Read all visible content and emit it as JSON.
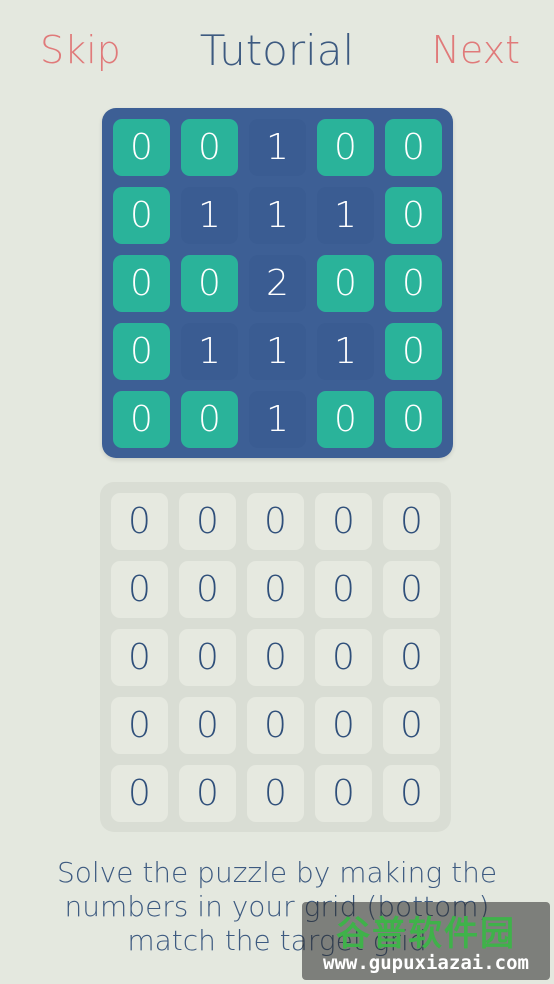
{
  "header": {
    "skip_label": "Skip",
    "title": "Tutorial",
    "next_label": "Next"
  },
  "target_grid": {
    "values": [
      [
        "0",
        "0",
        "1",
        "0",
        "0"
      ],
      [
        "0",
        "1",
        "1",
        "1",
        "0"
      ],
      [
        "0",
        "0",
        "2",
        "0",
        "0"
      ],
      [
        "0",
        "1",
        "1",
        "1",
        "0"
      ],
      [
        "0",
        "0",
        "1",
        "0",
        "0"
      ]
    ],
    "colors": {
      "board": "#3d5f95",
      "zero_cell": "#2ab39a",
      "nonzero_cell": "#3a5c92"
    }
  },
  "player_grid": {
    "values": [
      [
        "0",
        "0",
        "0",
        "0",
        "0"
      ],
      [
        "0",
        "0",
        "0",
        "0",
        "0"
      ],
      [
        "0",
        "0",
        "0",
        "0",
        "0"
      ],
      [
        "0",
        "0",
        "0",
        "0",
        "0"
      ],
      [
        "0",
        "0",
        "0",
        "0",
        "0"
      ]
    ]
  },
  "instructions": {
    "text": "Solve the puzzle by making the numbers in your grid (bottom) match the target grid"
  },
  "watermark": {
    "cn_text": "谷普软件园",
    "url_text": "www.gupuxiazai.com"
  },
  "colors": {
    "accent": "#e07a7a",
    "text": "#3d5a80",
    "background": "#e4e8df"
  }
}
